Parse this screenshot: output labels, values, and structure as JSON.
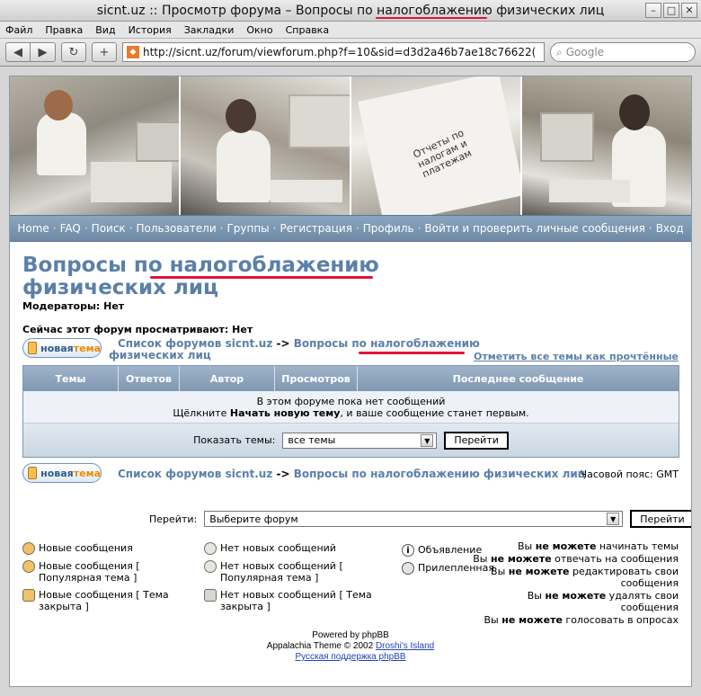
{
  "browser": {
    "title": "sicnt.uz :: Просмотр форума – Вопросы по налогоблажению физических лиц",
    "menu": [
      "Файл",
      "Правка",
      "Вид",
      "История",
      "Закладки",
      "Окно",
      "Справка"
    ],
    "url": "http://sicnt.uz/forum/viewforum.php?f=10&sid=d3d2a46b7ae18c76622(",
    "search_placeholder": "Google"
  },
  "banner": {
    "photo3_text": "Отчеты по налогам и платежам"
  },
  "nav": [
    "Home",
    "FAQ",
    "Поиск",
    "Пользователи",
    "Группы",
    "Регистрация",
    "Профиль",
    "Войти и проверить личные сообщения",
    "Вход"
  ],
  "forum": {
    "title_line1": "Вопросы по налогоблажению",
    "title_line2": "физических лиц",
    "moderators": "Модераторы: Нет",
    "viewing": "Сейчас этот форум просматривают: Нет",
    "new_topic_a": "новая",
    "new_topic_b": "тема",
    "breadcrumb_home": "Список форумов sicnt.uz",
    "breadcrumb_arrow": "->",
    "breadcrumb_current_a": "Вопросы по налогоблажению",
    "breadcrumb_current_b": "физических лиц",
    "breadcrumb_current_full": "Вопросы по налогоблажению физических лиц",
    "mark_read": "Отметить все темы как прочтённые"
  },
  "table": {
    "headers": [
      "Темы",
      "Ответов",
      "Автор",
      "Просмотров",
      "Последнее сообщение"
    ],
    "empty_line1": "В этом форуме пока нет сообщений",
    "empty_line2_pre": "Щёлкните ",
    "empty_line2_bold": "Начать новую тему",
    "empty_line2_post": ", и ваше сообщение станет первым.",
    "filter_label": "Показать темы:",
    "filter_value": "все темы",
    "go_label": "Перейти"
  },
  "timezone": "Часовой пояс: GMT",
  "jump": {
    "label": "Перейти:",
    "value": "Выберите форум",
    "button": "Перейти"
  },
  "legend": {
    "col1": [
      "Новые сообщения",
      "Новые сообщения [ Популярная тема ]",
      "Новые сообщения [ Тема закрыта ]"
    ],
    "col2": [
      "Нет новых сообщений",
      "Нет новых сообщений [ Популярная тема ]",
      "Нет новых сообщений [ Тема закрыта ]"
    ],
    "col3": [
      "Объявление",
      "Прилепленная"
    ]
  },
  "perms": [
    {
      "pre": "Вы ",
      "bold": "не можете",
      "post": " начинать темы"
    },
    {
      "pre": "Вы ",
      "bold": "не можете",
      "post": " отвечать на сообщения"
    },
    {
      "pre": "Вы ",
      "bold": "не можете",
      "post": " редактировать свои сообщения"
    },
    {
      "pre": "Вы ",
      "bold": "не можете",
      "post": " удалять свои сообщения"
    },
    {
      "pre": "Вы ",
      "bold": "не можете",
      "post": " голосовать в опросах"
    }
  ],
  "footer": {
    "powered": "Powered by phpBB",
    "theme_pre": "Appalachia Theme © 2002 ",
    "theme_link": "Droshi's Island",
    "support": "Русская поддержка phpBB"
  },
  "colors": {
    "accent_blue": "#5b80a8",
    "highlight_red": "#e2143c",
    "nav_bg": "#7f98b1"
  }
}
